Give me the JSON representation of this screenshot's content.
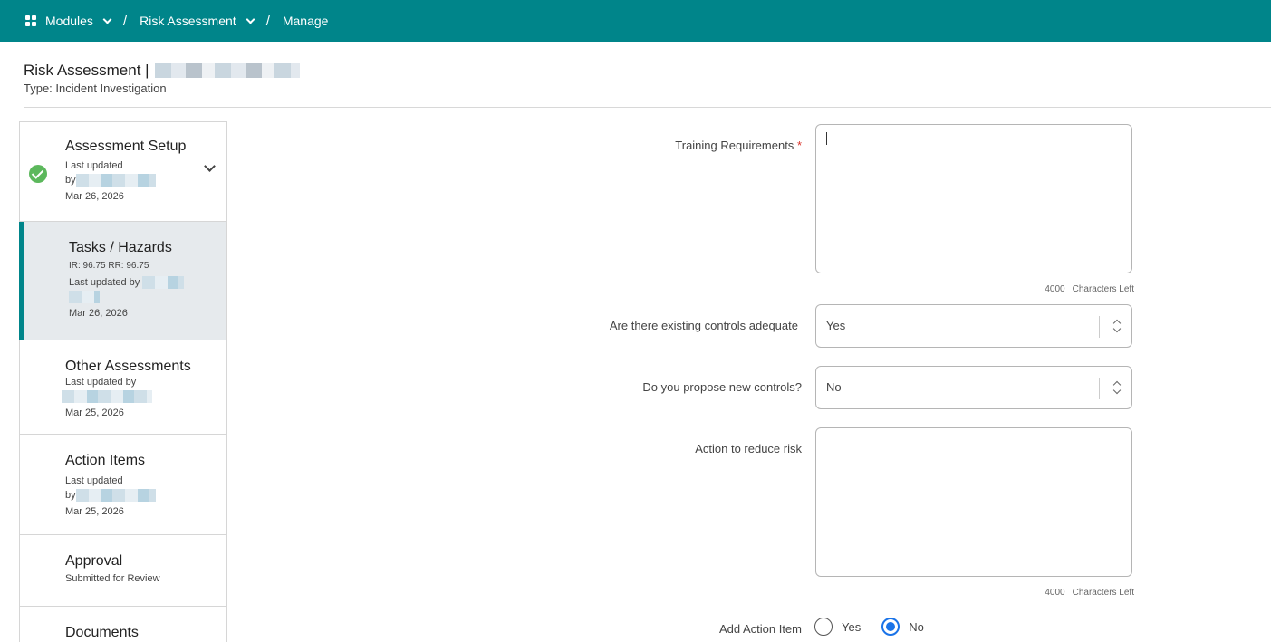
{
  "breadcrumb": {
    "modules": "Modules",
    "risk_assessment": "Risk Assessment",
    "manage": "Manage",
    "separator": "/"
  },
  "header": {
    "title": "Risk Assessment |",
    "type": "Type: Incident Investigation"
  },
  "sidebar": {
    "steps": [
      {
        "name": "Assessment Setup",
        "updated_label": "Last updated",
        "by_label": "by",
        "date": "Mar 26, 2026",
        "status": "complete"
      },
      {
        "name": "Tasks / Hazards",
        "scores": "IR: 96.75 RR: 96.75",
        "updated_label": "Last updated by",
        "date": "Mar 26, 2026",
        "status": "active"
      },
      {
        "name": "Other Assessments",
        "updated_label": "Last updated by",
        "date": "Mar 25, 2026"
      },
      {
        "name": "Action Items",
        "updated_label": "Last updated",
        "by_label": "by",
        "date": "Mar 25, 2026"
      },
      {
        "name": "Approval",
        "status_text": "Submitted for Review"
      },
      {
        "name": "Documents"
      }
    ]
  },
  "form": {
    "training": {
      "label": "Training Requirements",
      "required_mark": "*",
      "value": "",
      "count": "4000",
      "count_label": "Characters Left"
    },
    "existing_controls": {
      "label": "Are there existing controls adequate",
      "value": "Yes"
    },
    "new_controls": {
      "label": "Do you propose new controls?",
      "value": "No"
    },
    "action": {
      "label": "Action to reduce risk",
      "value": "",
      "count": "4000",
      "count_label": "Characters Left"
    },
    "add_action_item": {
      "label": "Add Action Item",
      "options": [
        "Yes",
        "No"
      ],
      "selected": "No"
    }
  },
  "colors": {
    "brand": "#00858a",
    "check": "#5cb85c",
    "radio_selected": "#1a73e8",
    "required": "#d9342b"
  }
}
